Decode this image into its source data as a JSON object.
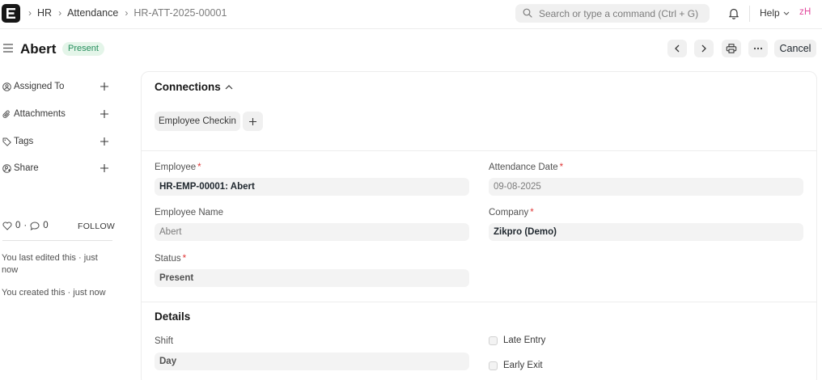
{
  "navbar": {
    "breadcrumbs": [
      "HR",
      "Attendance",
      "HR-ATT-2025-00001"
    ],
    "search_placeholder": "Search or type a command (Ctrl + G)",
    "help_label": "Help",
    "avatar_initials": "zH"
  },
  "page": {
    "title": "Abert",
    "status": "Present",
    "cancel_label": "Cancel"
  },
  "sidebar": {
    "items": [
      {
        "label": "Assigned To",
        "icon": "user-assign-icon"
      },
      {
        "label": "Attachments",
        "icon": "paperclip-icon"
      },
      {
        "label": "Tags",
        "icon": "tag-icon"
      },
      {
        "label": "Share",
        "icon": "share-user-icon"
      }
    ],
    "likes": "0",
    "comments": "0",
    "follow_label": "FOLLOW",
    "activity": [
      "You last edited this · just now",
      "You created this · just now"
    ]
  },
  "connections": {
    "title": "Connections",
    "links": [
      "Employee Checkin"
    ]
  },
  "form": {
    "employee": {
      "label": "Employee",
      "value": "HR-EMP-00001: Abert"
    },
    "attendance_date": {
      "label": "Attendance Date",
      "value": "09-08-2025"
    },
    "employee_name": {
      "label": "Employee Name",
      "value": "Abert"
    },
    "company": {
      "label": "Company",
      "value": "Zikpro (Demo)"
    },
    "status": {
      "label": "Status",
      "value": "Present"
    }
  },
  "details": {
    "title": "Details",
    "shift": {
      "label": "Shift",
      "value": "Day"
    },
    "late_entry": {
      "label": "Late Entry",
      "checked": false
    },
    "early_exit": {
      "label": "Early Exit",
      "checked": false
    }
  },
  "colors": {
    "status_green_bg": "#e4f5e9",
    "status_green_text": "#278f5e",
    "required_red": "#e03636",
    "avatar_pink": "#e2499d"
  }
}
